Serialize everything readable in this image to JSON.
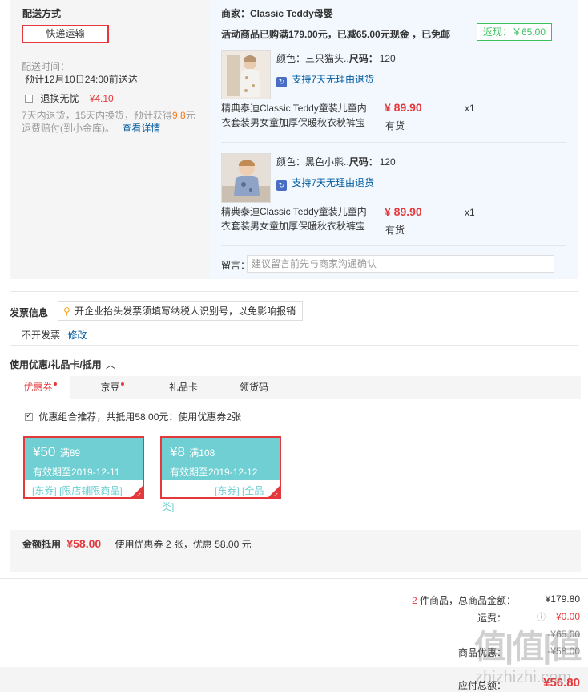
{
  "shipping": {
    "title": "配送方式",
    "method_button": "快递运输",
    "time_label": "配送时间：",
    "time_value": "预计12月10日24:00前送达",
    "insurance_label": "退换无忧",
    "insurance_price": "¥4.10",
    "insurance_desc_1": "7天内退货，15天内换货，预计获得",
    "insurance_desc_points": "9.8",
    "insurance_desc_2": "元",
    "insurance_desc_3": "运费赔付(到小金库)。",
    "insurance_detail_link": "查看详情"
  },
  "shop": {
    "merchant": "商家：Classic Teddy母婴",
    "promo": "活动商品已购满179.00元，已减65.00元现金 ，已免邮",
    "rebate": "返现：￥65.00",
    "products": [
      {
        "color_label": "颜色：",
        "color_value": "三只猫头..",
        "size_label": "尺码：",
        "size_value": "120",
        "return_policy": "支持7天无理由退货",
        "name_line1": "精典泰迪Classic Teddy童装儿童内",
        "name_line2": "衣套装男女童加厚保暖秋衣秋裤宝",
        "price": "¥ 89.90",
        "qty": "x1",
        "stock": "有货"
      },
      {
        "color_label": "颜色：",
        "color_value": "黑色小熊..",
        "size_label": "尺码：",
        "size_value": "120",
        "return_policy": "支持7天无理由退货",
        "name_line1": "精典泰迪Classic Teddy童装儿童内",
        "name_line2": "衣套装男女童加厚保暖秋衣秋裤宝",
        "price": "¥ 89.90",
        "qty": "x1",
        "stock": "有货"
      }
    ],
    "message_label": "留言：",
    "message_placeholder": "建议留言前先与商家沟通确认"
  },
  "invoice": {
    "title": "发票信息",
    "notice": "开企业抬头发票须填写纳税人识别号，以免影响报销",
    "status": "不开发票",
    "modify": "修改"
  },
  "discount": {
    "title": "使用优惠/礼品卡/抵用",
    "tabs": [
      "优惠券",
      "京豆",
      "礼品卡",
      "领货码"
    ],
    "combo_text": "优惠组合推荐，共抵用58.00元：使用优惠券2张",
    "coupons": [
      {
        "amount": "¥50",
        "condition": "满89",
        "validity": "有效期至2019-12-11",
        "scope": "[东券] [限店铺限商品]"
      },
      {
        "amount": "¥8",
        "condition": "满108",
        "validity": "有效期至2019-12-12",
        "scope": "[东券] [全品",
        "scope_overflow": "类]"
      }
    ],
    "summary_label": "金额抵用",
    "summary_amount": "¥58.00",
    "summary_desc": "使用优惠券 2 张，优惠 58.00 元"
  },
  "totals": {
    "count": "2",
    "count_label": "件商品，总商品金额：",
    "goods_total": "¥179.80",
    "freight_label": "运费：",
    "freight": "¥0.00",
    "rebate_value": "-¥65.00",
    "goods_discount_label": "商品优惠：",
    "goods_discount": "-¥58.00",
    "payable_label": "应付总额：",
    "payable": "¥56.80"
  },
  "watermark": {
    "text": "值|值|值",
    "url": "zhizhizhi.com"
  }
}
